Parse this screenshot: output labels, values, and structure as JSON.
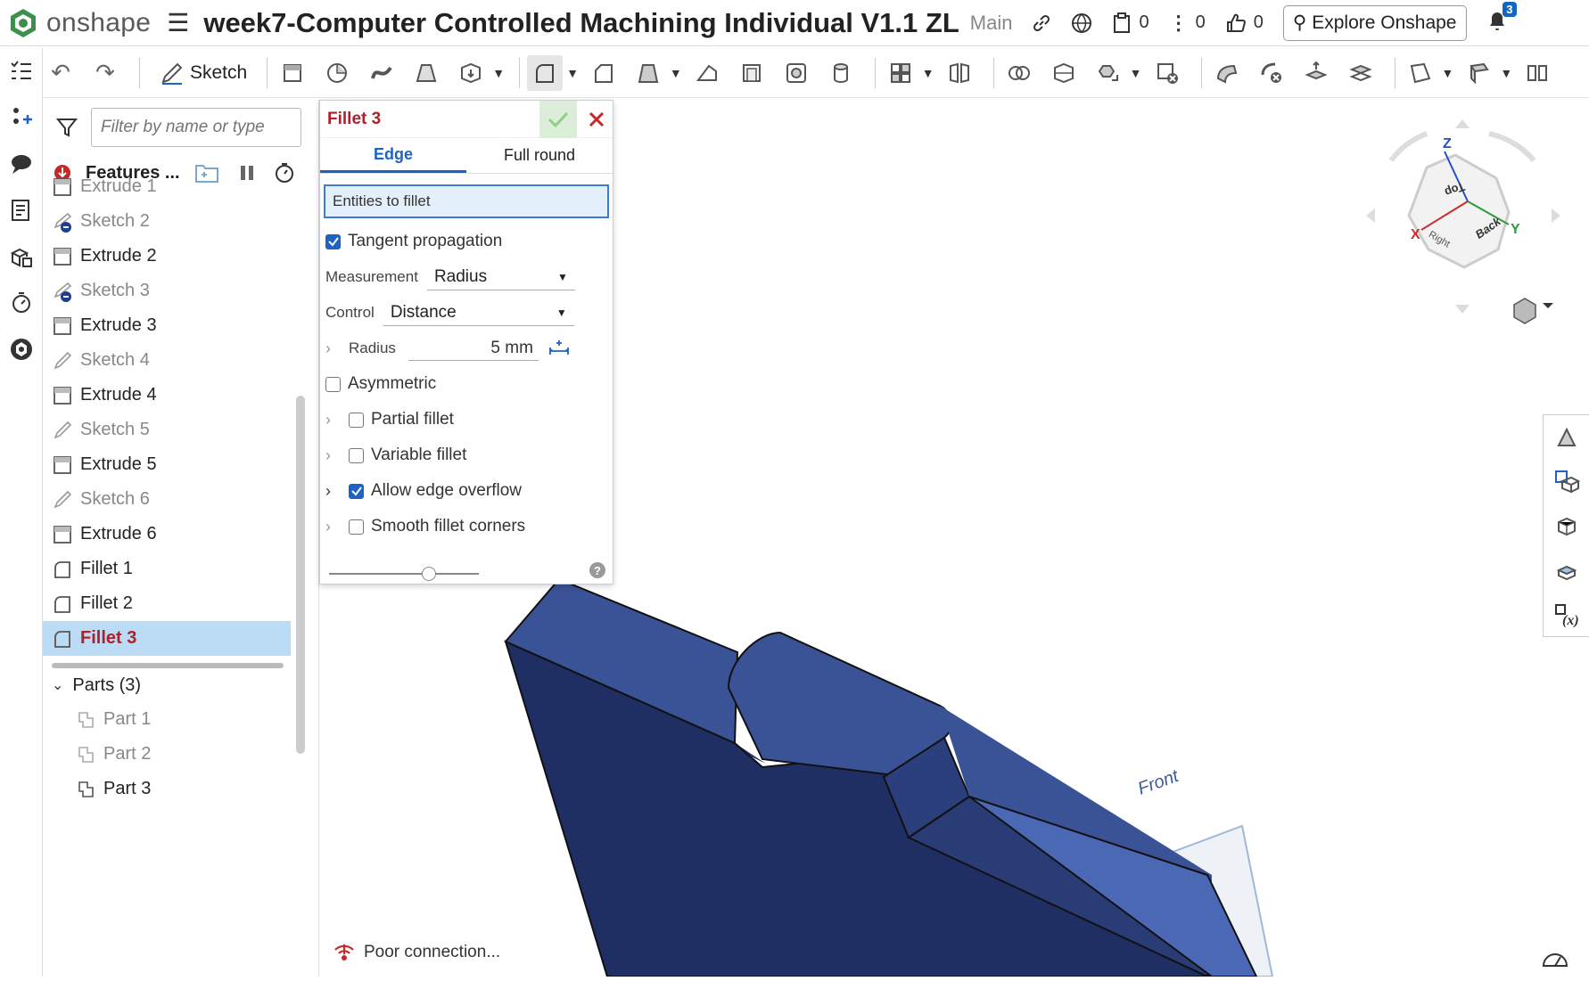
{
  "app": {
    "logo_text": "onshape",
    "doc_title": "week7-Computer Controlled Machining Individual V1.1 ZL",
    "branch": "Main"
  },
  "topbar": {
    "versions_count": "0",
    "info_count": "0",
    "likes_count": "0",
    "explore_label": "Explore Onshape",
    "notifications": "3"
  },
  "toolbar": {
    "sketch_label": "Sketch"
  },
  "feature_panel": {
    "filter_placeholder": "Filter by name or type",
    "header": "Features ...",
    "items": [
      {
        "label": "Extrude 1",
        "type": "extrude",
        "dim": true
      },
      {
        "label": "Sketch 2",
        "type": "sketch-hidden",
        "dim": true
      },
      {
        "label": "Extrude 2",
        "type": "extrude",
        "dim": false
      },
      {
        "label": "Sketch 3",
        "type": "sketch-hidden",
        "dim": true
      },
      {
        "label": "Extrude 3",
        "type": "extrude",
        "dim": false
      },
      {
        "label": "Sketch 4",
        "type": "sketch",
        "dim": true
      },
      {
        "label": "Extrude 4",
        "type": "extrude",
        "dim": false
      },
      {
        "label": "Sketch 5",
        "type": "sketch",
        "dim": true
      },
      {
        "label": "Extrude 5",
        "type": "extrude",
        "dim": false
      },
      {
        "label": "Sketch 6",
        "type": "sketch",
        "dim": true
      },
      {
        "label": "Extrude 6",
        "type": "extrude",
        "dim": false
      },
      {
        "label": "Fillet 1",
        "type": "fillet",
        "dim": false
      },
      {
        "label": "Fillet 2",
        "type": "fillet",
        "dim": false
      },
      {
        "label": "Fillet 3",
        "type": "fillet",
        "dim": false,
        "selected": true
      }
    ],
    "parts_header": "Parts (3)",
    "parts": [
      {
        "label": "Part 1",
        "active": false
      },
      {
        "label": "Part 2",
        "active": false
      },
      {
        "label": "Part 3",
        "active": true
      }
    ]
  },
  "dialog": {
    "title": "Fillet 3",
    "tabs": [
      "Edge",
      "Full round"
    ],
    "entities_label": "Entities to fillet",
    "tangent_label": "Tangent propagation",
    "measurement_label": "Measurement",
    "measurement_value": "Radius",
    "control_label": "Control",
    "control_value": "Distance",
    "radius_label": "Radius",
    "radius_value": "5 mm",
    "asymmetric_label": "Asymmetric",
    "partial_label": "Partial fillet",
    "variable_label": "Variable fillet",
    "overflow_label": "Allow edge overflow",
    "smooth_label": "Smooth fillet corners",
    "help": "?",
    "slider_level": 0.7
  },
  "viewcube": {
    "z": "Z",
    "y": "Y",
    "x": "X",
    "top": "Top",
    "back": "Back",
    "right": "Right"
  },
  "viewport": {
    "plane_label": "Front"
  },
  "status": {
    "text": "Poor connection..."
  },
  "colors": {
    "accent": "#1e63c4",
    "selected_text": "#b0202a",
    "part_blue": "#2d4585"
  }
}
